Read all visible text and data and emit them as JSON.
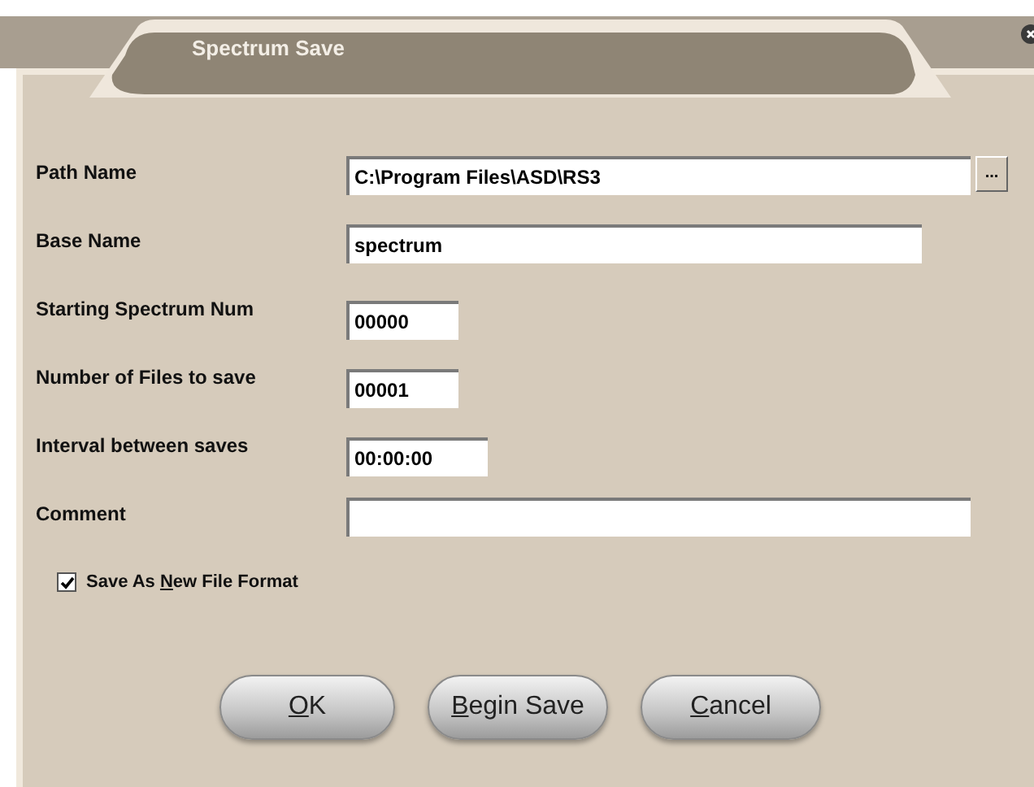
{
  "window": {
    "title": "Spectrum Save"
  },
  "fields": [
    {
      "label": "Path Name",
      "value": "C:\\Program Files\\ASD\\RS3",
      "kind": "wide",
      "browse": "..."
    },
    {
      "label": "Base Name",
      "value": "spectrum",
      "kind": "medium"
    },
    {
      "label": "Starting Spectrum Num",
      "value": "00000",
      "kind": "short"
    },
    {
      "label": "Number of Files to save",
      "value": "00001",
      "kind": "short"
    },
    {
      "label": "Interval between saves",
      "value": "00:00:00",
      "kind": "time"
    },
    {
      "label": "Comment",
      "kind": "wide"
    }
  ],
  "checkbox": {
    "label_before": "Save As ",
    "access_key": "N",
    "label_after": "ew File Format",
    "checked": true
  },
  "buttons": [
    {
      "access_key": "O",
      "label_after": "K"
    },
    {
      "access_key": "B",
      "label_after": "egin Save"
    },
    {
      "access_key": "C",
      "label_after": "ancel"
    }
  ]
}
